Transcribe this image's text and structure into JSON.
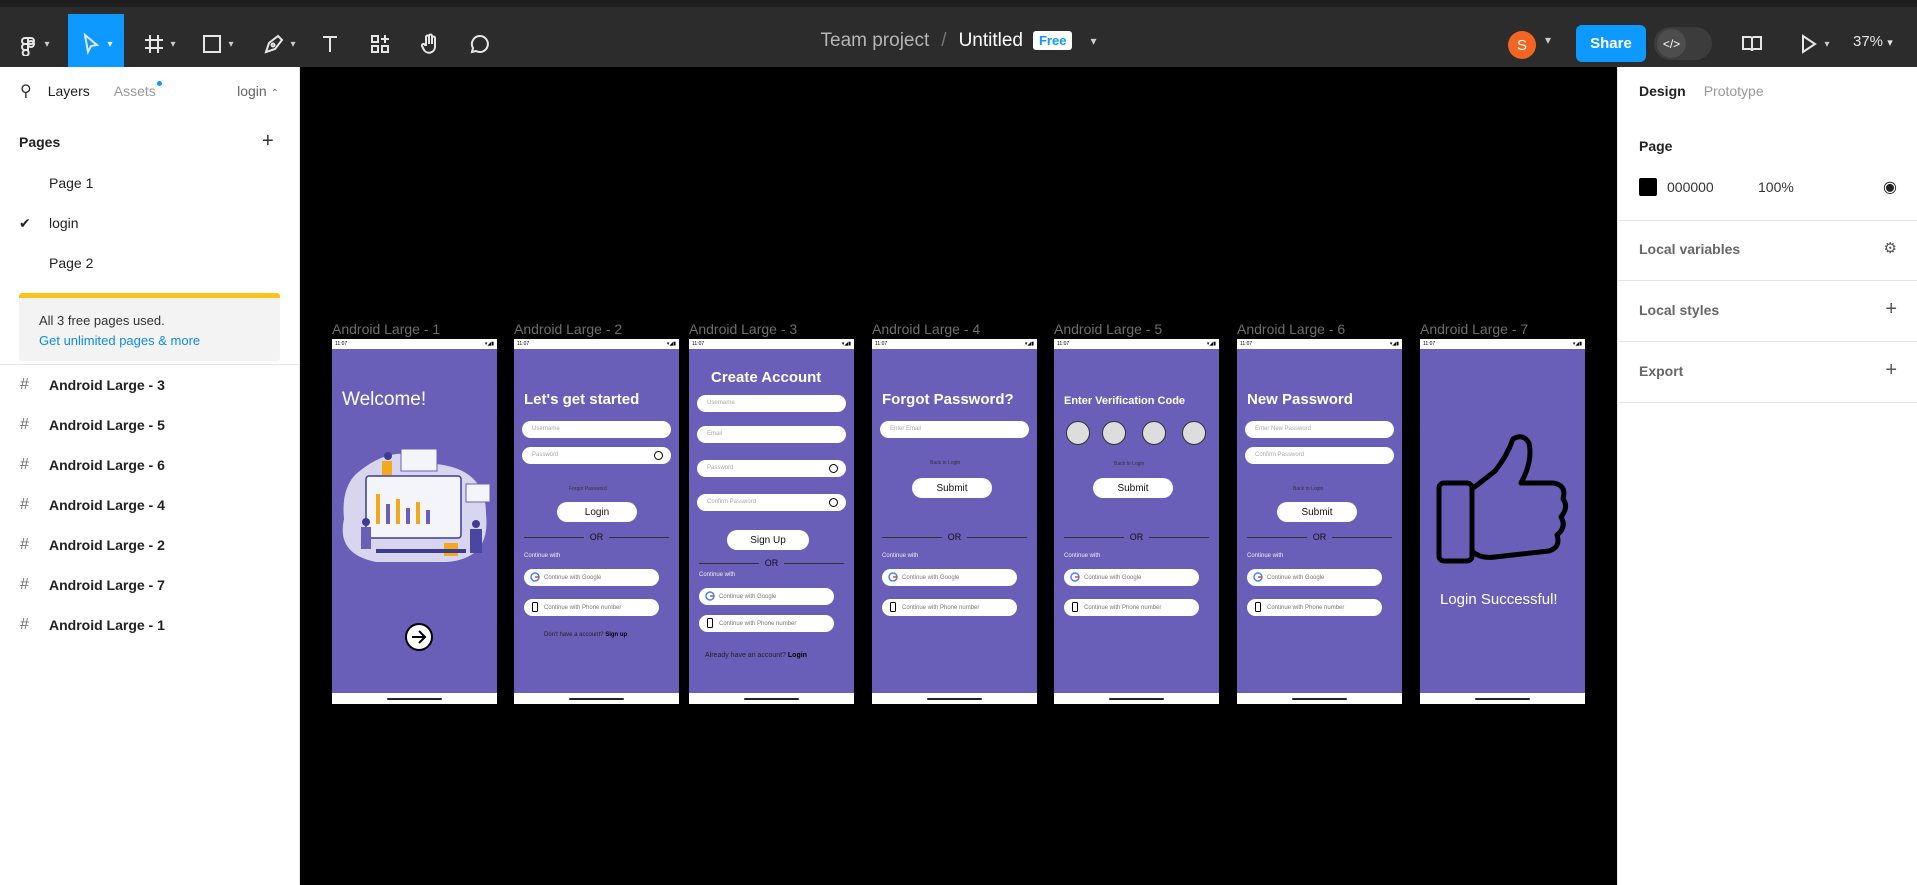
{
  "toolbar": {
    "project": "Team project",
    "separator": "/",
    "file_name": "Untitled",
    "plan_badge": "Free",
    "share_label": "Share",
    "avatar_initial": "S",
    "zoom": "37%"
  },
  "left_panel": {
    "tab_layers": "Layers",
    "tab_assets": "Assets",
    "page_selector": "login",
    "pages_heading": "Pages",
    "pages": [
      "Page 1",
      "login",
      "Page 2"
    ],
    "limit_notice": "All 3 free pages used.",
    "limit_link": "Get unlimited pages & more",
    "layers": [
      "Android Large - 3",
      "Android Large - 5",
      "Android Large - 6",
      "Android Large - 4",
      "Android Large - 2",
      "Android Large - 7",
      "Android Large - 1"
    ]
  },
  "right_panel": {
    "tab_design": "Design",
    "tab_prototype": "Prototype",
    "page_heading": "Page",
    "page_color": "000000",
    "page_opacity": "100%",
    "local_variables": "Local variables",
    "local_styles": "Local styles",
    "export": "Export"
  },
  "frames": {
    "labels": [
      "Android Large - 1",
      "Android Large - 2",
      "Android Large - 3",
      "Android Large - 4",
      "Android Large - 5",
      "Android Large - 6",
      "Android Large - 7"
    ],
    "status_time": "11:07",
    "welcome": "Welcome!",
    "get_started": "Let's get started",
    "create_account": "Create Account",
    "forgot_password": "Forgot Password?",
    "verification": "Enter Verification Code",
    "new_password": "New Password",
    "login_success": "Login Successful!",
    "username": "Username",
    "password": "Password",
    "email": "Email",
    "confirm_password": "Confirm Password",
    "enter_email": "Enter Email",
    "enter_new_password": "Enter New Password",
    "forgot_link": "Forgot Password",
    "back_to_login": "Back to Login",
    "login_btn": "Login",
    "signup_btn": "Sign Up",
    "submit_btn": "Submit",
    "or": "OR",
    "continue_with": "Continue with",
    "google": "Continue with Google",
    "phone": "Continue with Phone number",
    "no_account": "Don't have a account?",
    "sign_up": "Sign up",
    "have_account": "Already have an account?",
    "login_link": "Login"
  },
  "colors": {
    "accent": "#0d99ff",
    "frame_bg": "#6a5fb8",
    "toolbar_bg": "#2c2c2c",
    "avatar": "#f26522",
    "warning": "#ffc21a"
  }
}
